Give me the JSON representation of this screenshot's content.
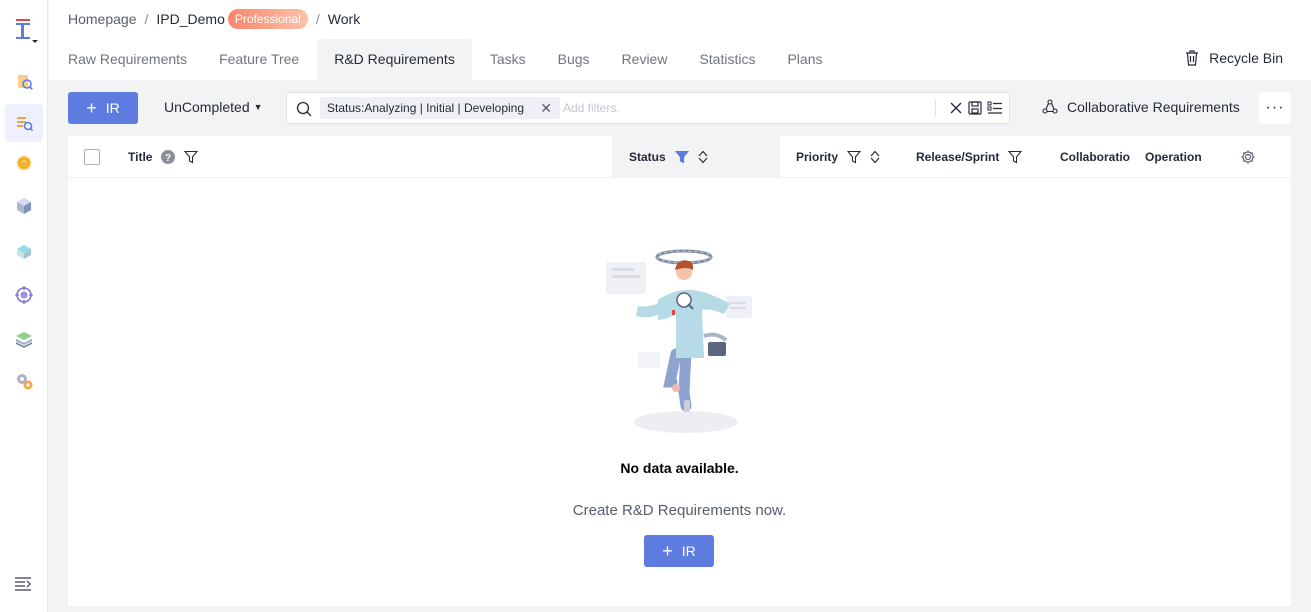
{
  "breadcrumb": {
    "home": "Homepage",
    "project": "IPD_Demo",
    "badge": "Professional",
    "current": "Work"
  },
  "tabs": [
    {
      "label": "Raw Requirements"
    },
    {
      "label": "Feature Tree"
    },
    {
      "label": "R&D Requirements",
      "active": true
    },
    {
      "label": "Tasks"
    },
    {
      "label": "Bugs"
    },
    {
      "label": "Review"
    },
    {
      "label": "Statistics"
    },
    {
      "label": "Plans"
    }
  ],
  "recycle_bin": "Recycle Bin",
  "toolbar": {
    "create_label": "IR",
    "scope_label": "UnCompleted",
    "filter_chip": "Status:Analyzing | Initial | Developing",
    "filter_placeholder": "Add filters.",
    "collab_label": "Collaborative Requirements",
    "more_label": "···"
  },
  "columns": {
    "title": "Title",
    "status": "Status",
    "priority": "Priority",
    "release": "Release/Sprint",
    "collab": "Collaboratio",
    "operation": "Operation"
  },
  "empty_state": {
    "title": "No data available.",
    "subtitle": "Create R&D Requirements now.",
    "button_label": "IR"
  },
  "colors": {
    "primary": "#5e7ce0",
    "badge_gradient_start": "#f7856c",
    "badge_gradient_end": "#fbc3a8"
  },
  "icons": {
    "rail": [
      "app-logo-icon",
      "raw-requirements-icon",
      "rd-requirements-icon",
      "smile-icon",
      "cube-icon",
      "box-icon",
      "target-icon",
      "stack-icon",
      "settings-gear-icon",
      "menu-expand-icon"
    ]
  }
}
